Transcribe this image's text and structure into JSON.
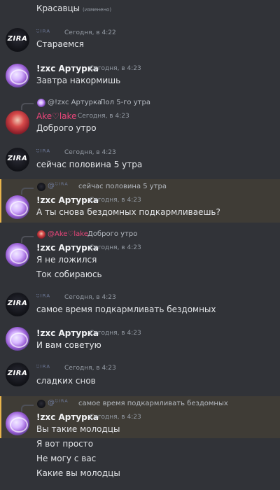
{
  "top_message": {
    "text": "Красавцы",
    "edited": "(изменено)"
  },
  "users": {
    "zira": {
      "name": "′I̲R̲′",
      "avatar_text": "ZIRA"
    },
    "artur": {
      "name": "!zxc Артурка"
    },
    "ake": {
      "name": "Ake♡lake"
    }
  },
  "messages": [
    {
      "author": "ᵕ̈ᴵᴿᴬ",
      "time": "Сегодня, в 4:22",
      "lines": [
        "Стараемся"
      ]
    },
    {
      "author": "!zxc Артурка",
      "time": "Сегодня, в 4:23",
      "lines": [
        "Завтра накормишь"
      ]
    },
    {
      "reply_to": "@!zxc Артурка",
      "reply_text": "Пол 5-го утра",
      "author": "Ake♡lake",
      "time": "Сегодня, в 4:23",
      "lines": [
        "Доброго утро"
      ]
    },
    {
      "author": "ᵕ̈ᴵᴿᴬ",
      "time": "Сегодня, в 4:23",
      "lines": [
        "сейчас половина 5 утра"
      ]
    },
    {
      "reply_to": "@ᵕ̈ᴵᴿᴬ",
      "reply_text": "сейчас половина 5 утра",
      "author": "!zxc Артурка",
      "time": "Сегодня, в 4:23",
      "lines": [
        "А ты снова бездомных подкармливаешь?"
      ]
    },
    {
      "reply_to": "@Ake♡lake",
      "reply_text": "Доброго утро",
      "author": "!zxc Артурка",
      "time": "Сегодня, в 4:23",
      "lines": [
        "Я не ложился",
        "Ток собираюсь"
      ]
    },
    {
      "author": "ᵕ̈ᴵᴿᴬ",
      "time": "Сегодня, в 4:23",
      "lines": [
        "самое время подкармливать бездомных"
      ]
    },
    {
      "author": "!zxc Артурка",
      "time": "Сегодня, в 4:23",
      "lines": [
        "И вам советую"
      ]
    },
    {
      "author": "ᵕ̈ᴵᴿᴬ",
      "time": "Сегодня, в 4:23",
      "lines": [
        "сладких снов"
      ]
    },
    {
      "reply_to": "@ᵕ̈ᴵᴿᴬ",
      "reply_text": "самое время подкармливать бездомных",
      "author": "!zxc Артурка",
      "time": "Сегодня, в 4:23",
      "lines": [
        "Вы такие молодцы",
        "Я вот просто",
        "Не могу с вас",
        "Какие вы молодцы"
      ]
    }
  ],
  "colors": {
    "background": "#313338",
    "mention_highlight": "#3f3c36",
    "mention_bar": "#e8b44c",
    "ake_name": "#e9467a"
  },
  "icons": {
    "zira_avatar": "zira-logo-avatar",
    "artur_avatar": "anime-avatar",
    "ake_avatar": "red-hair-anime-avatar"
  }
}
